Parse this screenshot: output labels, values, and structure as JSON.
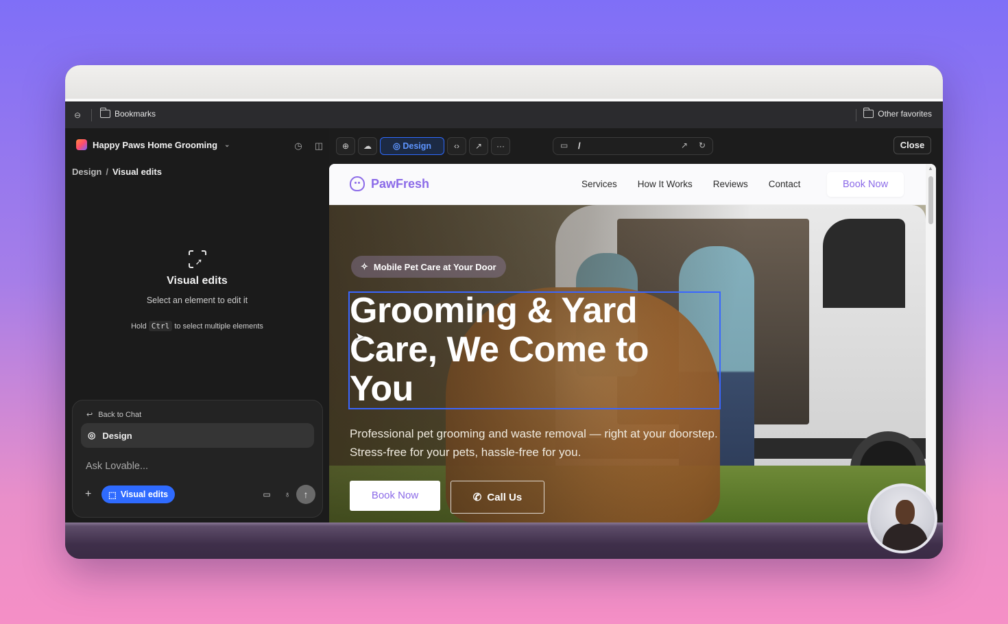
{
  "bookmarks_bar": {
    "folder_label": "Bookmarks",
    "other_label": "Other favorites"
  },
  "app": {
    "project_name": "Happy Paws Home Grooming",
    "breadcrumb": {
      "parent": "Design",
      "current": "Visual edits"
    },
    "empty_state": {
      "title": "Visual edits",
      "subtitle": "Select an element to edit it",
      "hint_prefix": "Hold",
      "hint_key": "Ctrl",
      "hint_suffix": "to select multiple elements"
    },
    "chat": {
      "back_label": "Back to Chat",
      "mode_label": "Design",
      "placeholder": "Ask Lovable...",
      "visual_edits_label": "Visual edits"
    },
    "toolbar": {
      "design_label": "Design",
      "url_path": "/",
      "close_label": "Close"
    }
  },
  "site": {
    "brand": "PawFresh",
    "nav": [
      "Services",
      "How It Works",
      "Reviews",
      "Contact"
    ],
    "nav_cta": "Book Now",
    "badge": "Mobile Pet Care at Your Door",
    "headline_lines": [
      "Grooming & Yard",
      "Care, We Come to",
      "You"
    ],
    "subtitle": "Professional pet grooming and waste removal — right at your doorstep. Stress-free for your pets, hassle-free for you.",
    "cta_primary": "Book Now",
    "cta_secondary": "Call Us"
  },
  "colors": {
    "accent_blue": "#2f6bff",
    "brand_purple": "#8b6ae8"
  }
}
